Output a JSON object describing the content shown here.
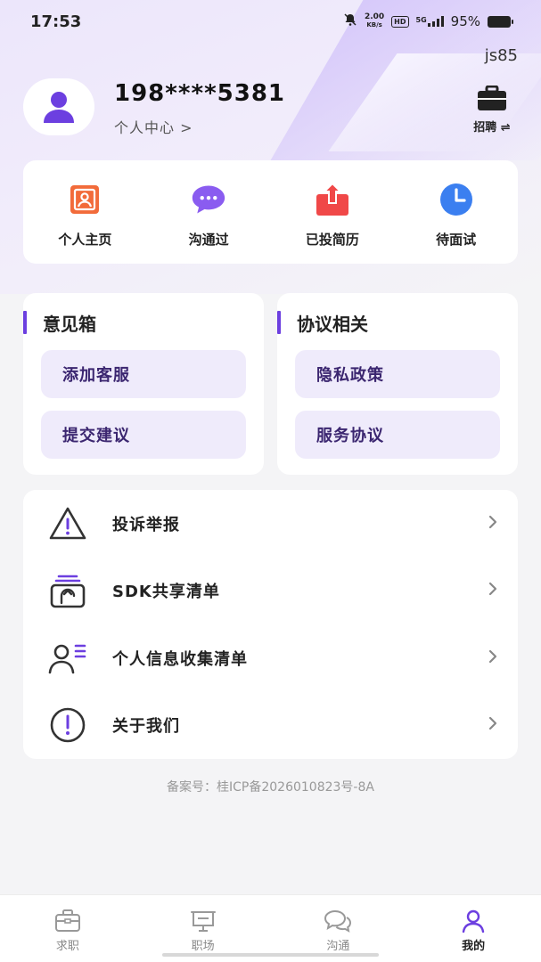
{
  "status_bar": {
    "time": "17:53",
    "net_speed_value": "2.00",
    "net_speed_unit": "KB/s",
    "hd_label": "HD",
    "signal_label": "5G",
    "battery": "95%"
  },
  "header": {
    "tag": "js85",
    "phone": "198****5381",
    "personal_center": "个人中心 >",
    "recruit_label": "招聘 ⇌"
  },
  "quick_actions": [
    {
      "label": "个人主页",
      "icon": "profile-page-icon",
      "color": "#f26b3a"
    },
    {
      "label": "沟通过",
      "icon": "chat-bubble-icon",
      "color": "#8a5cf0"
    },
    {
      "label": "已投简历",
      "icon": "upload-resume-icon",
      "color": "#f04848"
    },
    {
      "label": "待面试",
      "icon": "clock-icon",
      "color": "#3b7ff0"
    }
  ],
  "feedback_box": {
    "title": "意见箱",
    "items": [
      "添加客服",
      "提交建议"
    ]
  },
  "agreement_box": {
    "title": "协议相关",
    "items": [
      "隐私政策",
      "服务协议"
    ]
  },
  "menu": [
    {
      "label": "投诉举报",
      "icon": "warning-icon"
    },
    {
      "label": "SDK共享清单",
      "icon": "sdk-share-icon"
    },
    {
      "label": "个人信息收集清单",
      "icon": "user-list-icon"
    },
    {
      "label": "关于我们",
      "icon": "info-exclamation-icon"
    }
  ],
  "icp": "备案号：桂ICP备2026010823号-8A",
  "tabbar": [
    {
      "label": "求职",
      "icon": "briefcase-icon",
      "active": false
    },
    {
      "label": "职场",
      "icon": "presentation-icon",
      "active": false
    },
    {
      "label": "沟通",
      "icon": "chat-icon",
      "active": false
    },
    {
      "label": "我的",
      "icon": "user-icon",
      "active": true
    }
  ],
  "colors": {
    "accent": "#6c3fe0",
    "pill_bg": "#efebfb",
    "pill_text": "#3b2670"
  }
}
